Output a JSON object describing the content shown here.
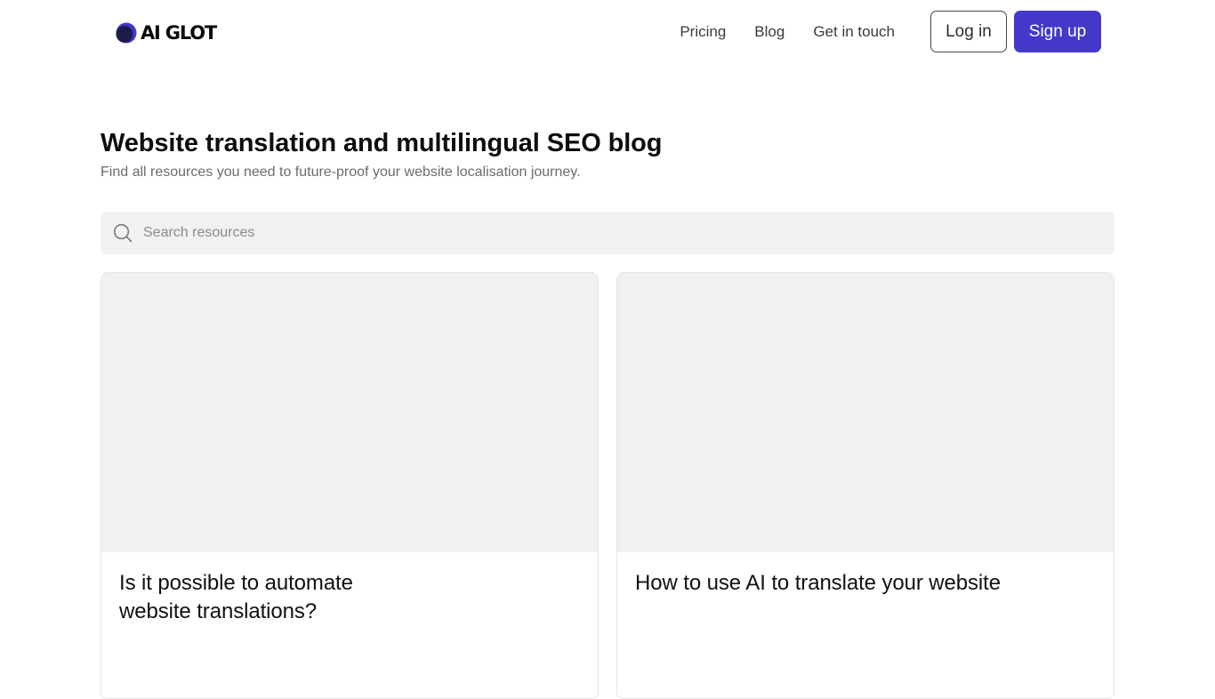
{
  "nav": {
    "brand": "AI GLOT",
    "links": [
      "Pricing",
      "Blog",
      "Get in touch"
    ],
    "login_label": "Log in",
    "signup_label": "Sign up"
  },
  "header": {
    "title": "Website translation and multilingual SEO blog",
    "subtitle": "Find all resources you need to future-proof your website localisation journey."
  },
  "search": {
    "placeholder": "Search resources",
    "value": ""
  },
  "posts": [
    {
      "title": "Is it possible to automate website translations?"
    },
    {
      "title": "How to use AI to translate your website"
    }
  ],
  "colors": {
    "brand": "#4338ca",
    "logo_dark": "#1e1b4b",
    "surface_gray": "#f1f1f1"
  },
  "icons": [
    "logo-mark-icon",
    "search-icon"
  ]
}
